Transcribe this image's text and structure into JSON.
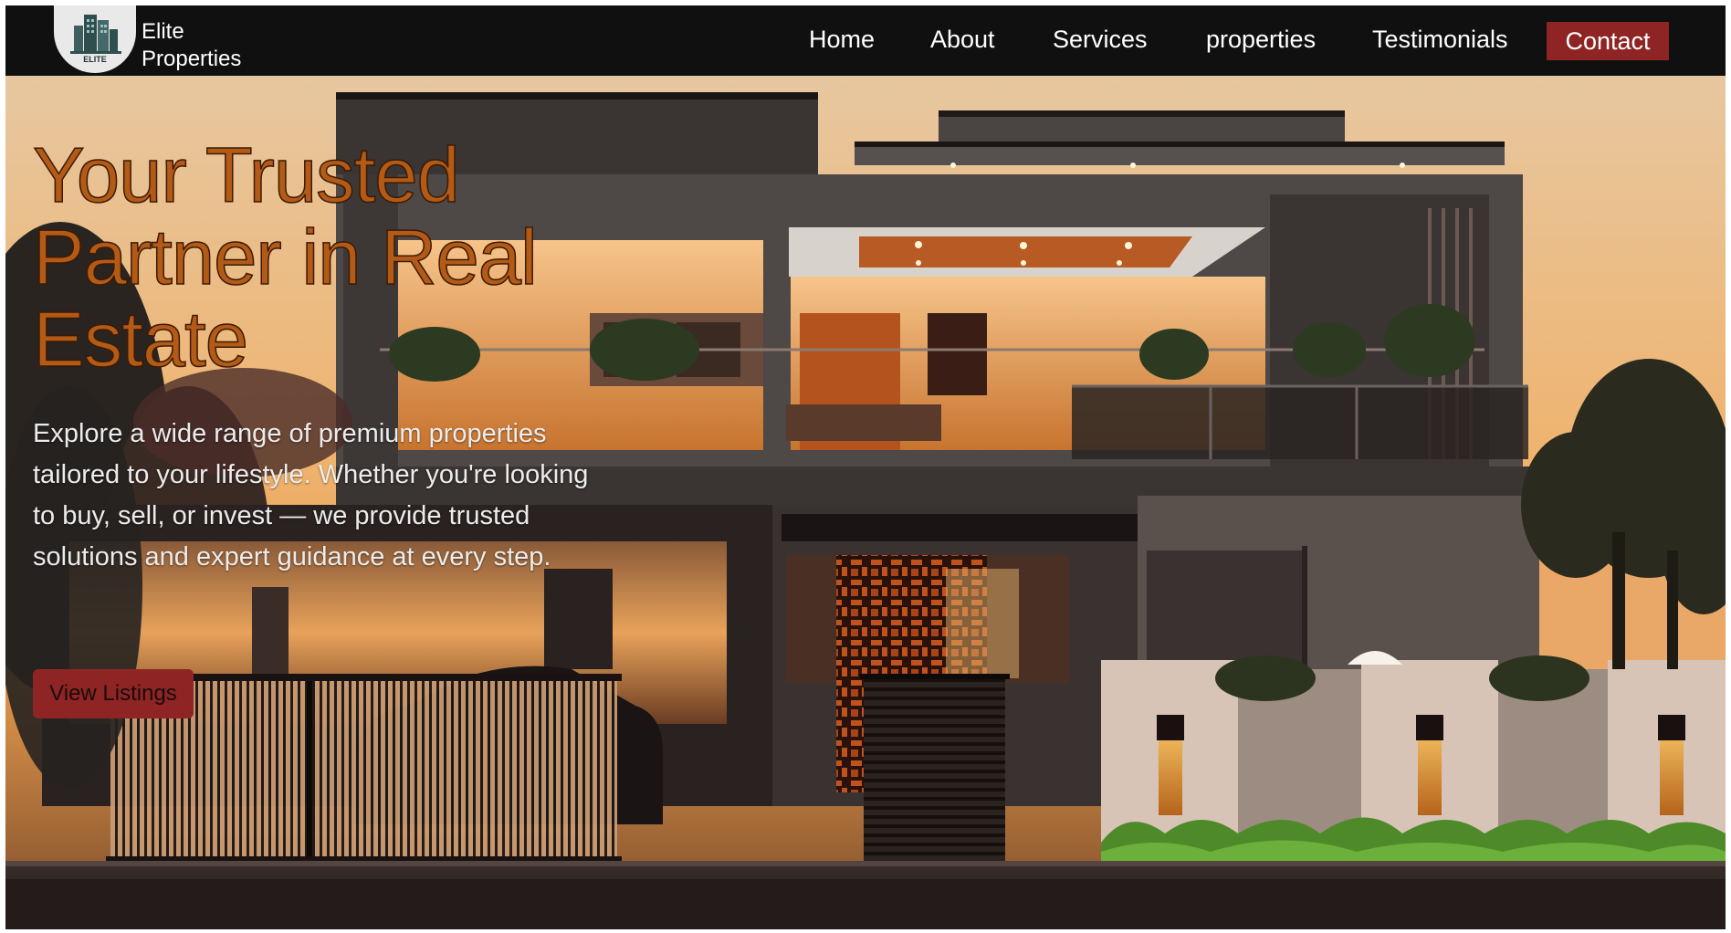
{
  "brand": {
    "logo_icon": "building-logo-icon",
    "logo_text": "ELITE",
    "name_line1": "Elite",
    "name_line2": "Properties"
  },
  "nav": {
    "items": [
      {
        "label": "Home"
      },
      {
        "label": "About"
      },
      {
        "label": "Services"
      },
      {
        "label": "properties"
      },
      {
        "label": "Testimonials"
      }
    ],
    "contact_label": "Contact"
  },
  "hero": {
    "title_line1": "Your Trusted",
    "title_line2": "Partner in Real",
    "title_line3": "Estate",
    "description": "Explore a wide range of premium properties tailored to your lifestyle. Whether you're looking to buy, sell, or invest — we provide trusted solutions and expert guidance at every step.",
    "button_label": "View Listings",
    "background": "modern-house-at-dusk-image"
  },
  "colors": {
    "navbar_bg": "#101010",
    "accent_red": "#8e2424",
    "title_orange": "#b35a16"
  }
}
